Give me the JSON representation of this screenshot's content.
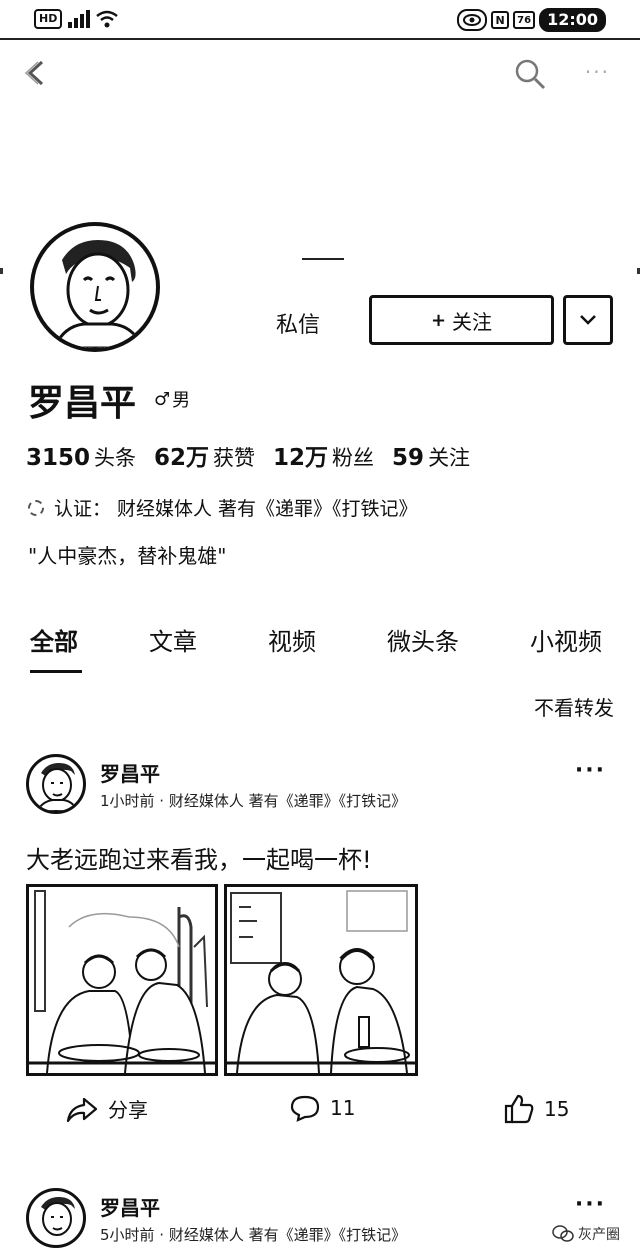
{
  "status_bar": {
    "hd": "HD",
    "nfc": "N",
    "battery": "76",
    "time": "12:00"
  },
  "profile": {
    "dm_label": "私信",
    "follow_label": "关注",
    "name": "罗昌平",
    "gender_symbol": "♂",
    "gender": "男",
    "stats": [
      {
        "num": "3150",
        "label": "头条"
      },
      {
        "num": "62万",
        "label": "获赞"
      },
      {
        "num": "12万",
        "label": "粉丝"
      },
      {
        "num": "59",
        "label": "关注"
      }
    ],
    "verify_prefix": "认证：",
    "verify_text": "财经媒体人 著有《递罪》《打铁记》",
    "bio": "\"人中豪杰，替补鬼雄\""
  },
  "tabs": [
    "全部",
    "文章",
    "视频",
    "微头条",
    "小视频"
  ],
  "filter_label": "不看转发",
  "posts": [
    {
      "author": "罗昌平",
      "meta": "1小时前 · 财经媒体人 著有《递罪》《打铁记》",
      "text": "大老远跑过来看我，一起喝一杯!",
      "share_label": "分享",
      "comments": "11",
      "likes": "15"
    },
    {
      "author": "罗昌平",
      "meta": "5小时前 · 财经媒体人 著有《递罪》《打铁记》"
    }
  ],
  "watermark": "灰产圈"
}
